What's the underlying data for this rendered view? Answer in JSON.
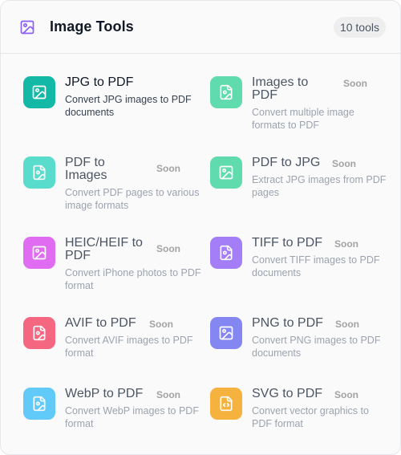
{
  "header": {
    "title": "Image Tools",
    "count": "10 tools",
    "icon": "image-icon",
    "icon_color": "#8b5cf6"
  },
  "tools": [
    {
      "name_line1": "JPG to PDF",
      "name_line2": "",
      "desc": "Convert JPG images to PDF documents",
      "soon": "",
      "icon": "image-icon",
      "color": "#14b8a6",
      "active": true
    },
    {
      "name_line1": "Images to",
      "name_line2": "PDF",
      "desc": "Convert multiple image formats to PDF",
      "soon": "Soon",
      "icon": "file-image-icon",
      "color": "#34d399",
      "active": false
    },
    {
      "name_line1": "PDF to",
      "name_line2": "Images",
      "desc": "Convert PDF pages to various image formats",
      "soon": "Soon",
      "icon": "file-image-icon",
      "color": "#2dd4bf",
      "active": false
    },
    {
      "name_line1": "PDF to JPG",
      "name_line2": "",
      "desc": "Extract JPG images from PDF pages",
      "soon": "Soon",
      "icon": "image-icon",
      "color": "#34d399",
      "active": false
    },
    {
      "name_line1": "HEIC/HEIF to",
      "name_line2": "PDF",
      "desc": "Convert iPhone photos to PDF format",
      "soon": "Soon",
      "icon": "image-icon",
      "color": "#d946ef",
      "active": false
    },
    {
      "name_line1": "TIFF to PDF",
      "name_line2": "",
      "desc": "Convert TIFF images to PDF documents",
      "soon": "Soon",
      "icon": "file-image-icon",
      "color": "#8b5cf6",
      "active": false
    },
    {
      "name_line1": "AVIF to PDF",
      "name_line2": "",
      "desc": "Convert AVIF images to PDF format",
      "soon": "Soon",
      "icon": "file-image-icon",
      "color": "#f43f5e",
      "active": false
    },
    {
      "name_line1": "PNG to PDF",
      "name_line2": "",
      "desc": "Convert PNG images to PDF documents",
      "soon": "Soon",
      "icon": "image-icon",
      "color": "#6366f1",
      "active": false
    },
    {
      "name_line1": "WebP to PDF",
      "name_line2": "",
      "desc": "Convert WebP images to PDF format",
      "soon": "Soon",
      "icon": "file-image-icon",
      "color": "#38bdf8",
      "active": false
    },
    {
      "name_line1": "SVG to PDF",
      "name_line2": "",
      "desc": "Convert vector graphics to PDF format",
      "soon": "Soon",
      "icon": "file-code-icon",
      "color": "#f59e0b",
      "active": false
    }
  ]
}
